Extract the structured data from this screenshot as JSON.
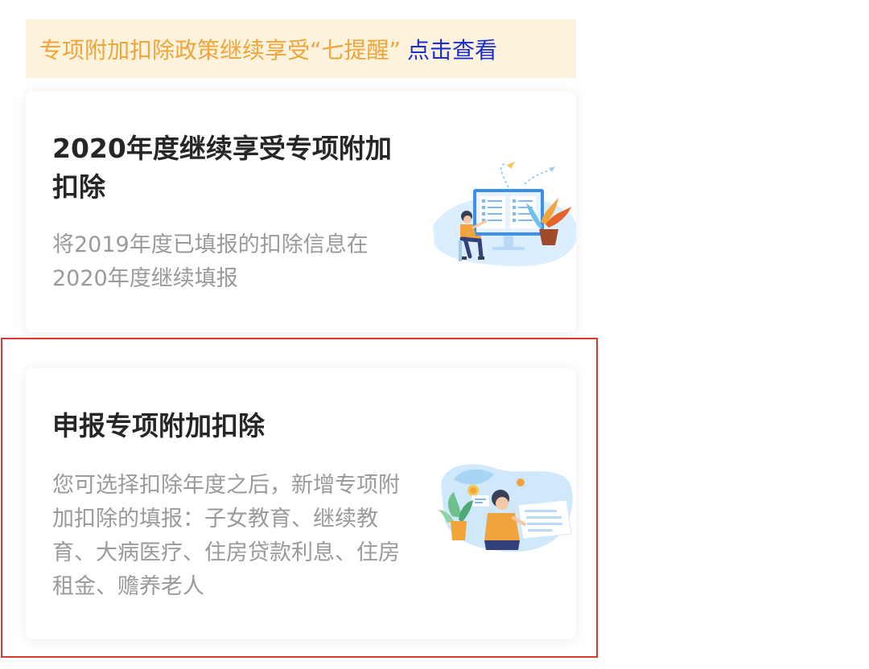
{
  "notice": {
    "text": "专项附加扣除政策继续享受“七提醒”",
    "link": "点击查看"
  },
  "cards": [
    {
      "title": "2020年度继续享受专项附加扣除",
      "description": "将2019年度已填报的扣除信息在2020年度继续填报",
      "illustration": "computer-form-person-illustration"
    },
    {
      "title": "申报专项附加扣除",
      "description": "您可选择扣除年度之后，新增专项附加扣除的填报：子女教育、继续教育、大病医疗、住房贷款利息、住房租金、赡养老人",
      "illustration": "person-with-document-illustration"
    }
  ],
  "colors": {
    "notice_bg": "#fdf3dc",
    "notice_text": "#f0a43a",
    "notice_link": "#1a2fd0",
    "title": "#262626",
    "description": "#9a9a9a",
    "highlight": "#d93a2b"
  }
}
